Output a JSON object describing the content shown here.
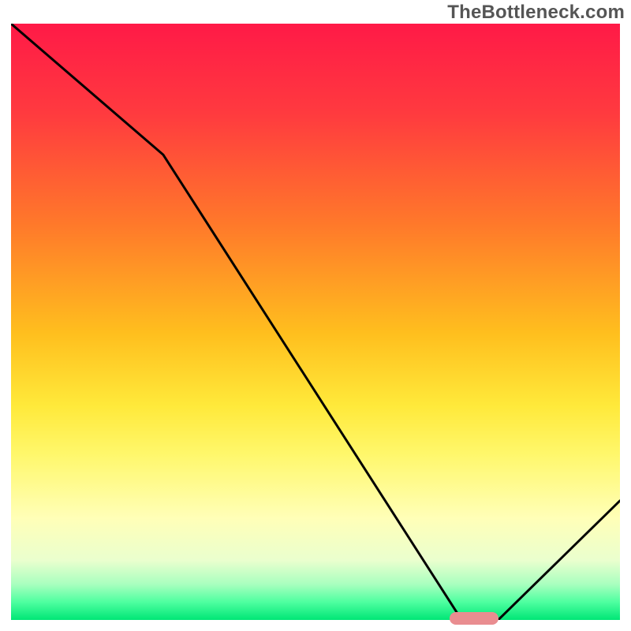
{
  "watermark": "TheBottleneck.com",
  "chart_data": {
    "type": "line",
    "title": "",
    "xlabel": "",
    "ylabel": "",
    "xlim": [
      0,
      100
    ],
    "ylim": [
      0,
      100
    ],
    "x": [
      0,
      25,
      74,
      80,
      100
    ],
    "values": [
      100,
      78,
      0,
      0,
      20
    ],
    "target_marker": {
      "x_start": 72,
      "x_end": 80,
      "y": 0
    },
    "gradient_stops": [
      {
        "pos": 0,
        "color": "#ff1a47"
      },
      {
        "pos": 15,
        "color": "#ff3a3f"
      },
      {
        "pos": 34,
        "color": "#ff7a2a"
      },
      {
        "pos": 52,
        "color": "#ffbf1e"
      },
      {
        "pos": 64,
        "color": "#ffe93a"
      },
      {
        "pos": 72,
        "color": "#fff76a"
      },
      {
        "pos": 83,
        "color": "#ffffb8"
      },
      {
        "pos": 90,
        "color": "#eaffce"
      },
      {
        "pos": 94,
        "color": "#a9ffbf"
      },
      {
        "pos": 97,
        "color": "#4effa0"
      },
      {
        "pos": 100,
        "color": "#00e676"
      }
    ]
  }
}
